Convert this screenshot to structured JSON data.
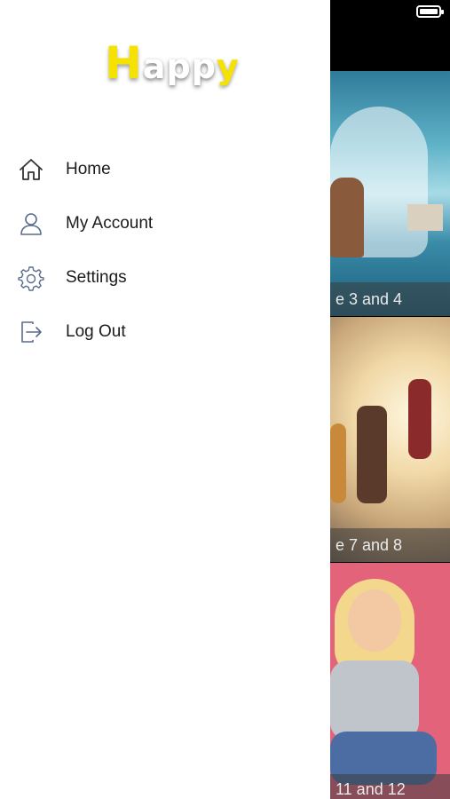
{
  "logo": {
    "h": "H",
    "middle": "app",
    "y": "y"
  },
  "menu": {
    "items": [
      {
        "label": "Home",
        "icon": "home-icon"
      },
      {
        "label": "My Account",
        "icon": "user-icon"
      },
      {
        "label": "Settings",
        "icon": "gear-icon"
      },
      {
        "label": "Log Out",
        "icon": "logout-icon"
      }
    ]
  },
  "cards": [
    {
      "caption": "e 3 and 4"
    },
    {
      "caption": "e 7 and 8"
    },
    {
      "caption": "11 and 12"
    }
  ],
  "colors": {
    "logo_yellow": "#f6e200",
    "menu_icon": "#5a6b8c",
    "menu_text": "#1b1b1b",
    "caption_bg": "#3c3c3c"
  }
}
